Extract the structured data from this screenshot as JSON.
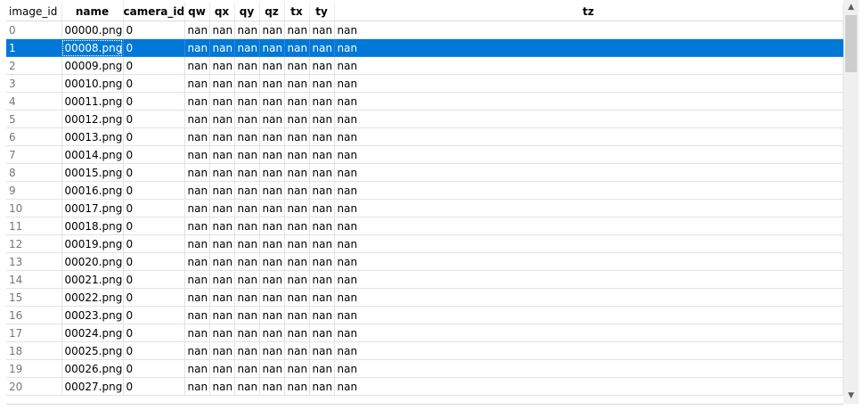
{
  "columns": [
    "image_id",
    "name",
    "camera_id",
    "qw",
    "qx",
    "qy",
    "qz",
    "tx",
    "ty",
    "tz"
  ],
  "selected_row": 1,
  "rows": [
    [
      "0",
      "00000.png",
      "0",
      "nan",
      "nan",
      "nan",
      "nan",
      "nan",
      "nan",
      "nan"
    ],
    [
      "1",
      "00008.png",
      "0",
      "nan",
      "nan",
      "nan",
      "nan",
      "nan",
      "nan",
      "nan"
    ],
    [
      "2",
      "00009.png",
      "0",
      "nan",
      "nan",
      "nan",
      "nan",
      "nan",
      "nan",
      "nan"
    ],
    [
      "3",
      "00010.png",
      "0",
      "nan",
      "nan",
      "nan",
      "nan",
      "nan",
      "nan",
      "nan"
    ],
    [
      "4",
      "00011.png",
      "0",
      "nan",
      "nan",
      "nan",
      "nan",
      "nan",
      "nan",
      "nan"
    ],
    [
      "5",
      "00012.png",
      "0",
      "nan",
      "nan",
      "nan",
      "nan",
      "nan",
      "nan",
      "nan"
    ],
    [
      "6",
      "00013.png",
      "0",
      "nan",
      "nan",
      "nan",
      "nan",
      "nan",
      "nan",
      "nan"
    ],
    [
      "7",
      "00014.png",
      "0",
      "nan",
      "nan",
      "nan",
      "nan",
      "nan",
      "nan",
      "nan"
    ],
    [
      "8",
      "00015.png",
      "0",
      "nan",
      "nan",
      "nan",
      "nan",
      "nan",
      "nan",
      "nan"
    ],
    [
      "9",
      "00016.png",
      "0",
      "nan",
      "nan",
      "nan",
      "nan",
      "nan",
      "nan",
      "nan"
    ],
    [
      "10",
      "00017.png",
      "0",
      "nan",
      "nan",
      "nan",
      "nan",
      "nan",
      "nan",
      "nan"
    ],
    [
      "11",
      "00018.png",
      "0",
      "nan",
      "nan",
      "nan",
      "nan",
      "nan",
      "nan",
      "nan"
    ],
    [
      "12",
      "00019.png",
      "0",
      "nan",
      "nan",
      "nan",
      "nan",
      "nan",
      "nan",
      "nan"
    ],
    [
      "13",
      "00020.png",
      "0",
      "nan",
      "nan",
      "nan",
      "nan",
      "nan",
      "nan",
      "nan"
    ],
    [
      "14",
      "00021.png",
      "0",
      "nan",
      "nan",
      "nan",
      "nan",
      "nan",
      "nan",
      "nan"
    ],
    [
      "15",
      "00022.png",
      "0",
      "nan",
      "nan",
      "nan",
      "nan",
      "nan",
      "nan",
      "nan"
    ],
    [
      "16",
      "00023.png",
      "0",
      "nan",
      "nan",
      "nan",
      "nan",
      "nan",
      "nan",
      "nan"
    ],
    [
      "17",
      "00024.png",
      "0",
      "nan",
      "nan",
      "nan",
      "nan",
      "nan",
      "nan",
      "nan"
    ],
    [
      "18",
      "00025.png",
      "0",
      "nan",
      "nan",
      "nan",
      "nan",
      "nan",
      "nan",
      "nan"
    ],
    [
      "19",
      "00026.png",
      "0",
      "nan",
      "nan",
      "nan",
      "nan",
      "nan",
      "nan",
      "nan"
    ],
    [
      "20",
      "00027.png",
      "0",
      "nan",
      "nan",
      "nan",
      "nan",
      "nan",
      "nan",
      "nan"
    ]
  ],
  "scrollbar": {
    "up_icon": "chevron-up-icon",
    "down_icon": "chevron-down-icon",
    "up_glyph": "▲",
    "down_glyph": "▼"
  },
  "colors": {
    "selection": "#0078d7",
    "row_index_text": "#777777"
  }
}
